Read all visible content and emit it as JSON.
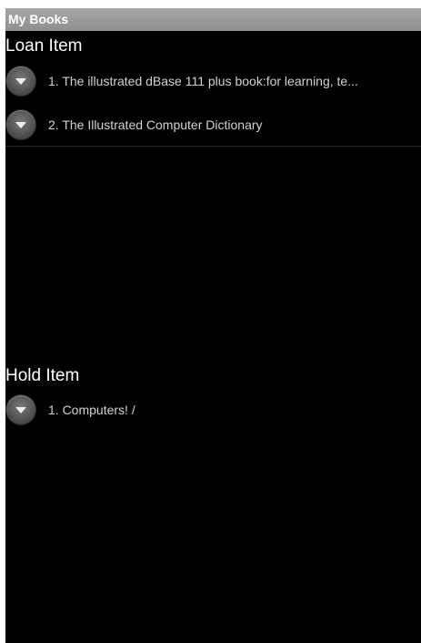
{
  "window": {
    "title": "My Books"
  },
  "loan_section": {
    "header": "Loan Item",
    "items": [
      {
        "label": "1. The illustrated dBase 111 plus book:for learning, te..."
      },
      {
        "label": "2. The Illustrated Computer Dictionary"
      }
    ]
  },
  "hold_section": {
    "header": "Hold Item",
    "items": [
      {
        "label": "1. Computers! /"
      }
    ]
  },
  "icons": {
    "expand": "chevron-down-icon"
  },
  "colors": {
    "title_bar": "#999999",
    "background": "#000000",
    "header_text": "#ffffff",
    "item_text": "#d2d2d2"
  }
}
